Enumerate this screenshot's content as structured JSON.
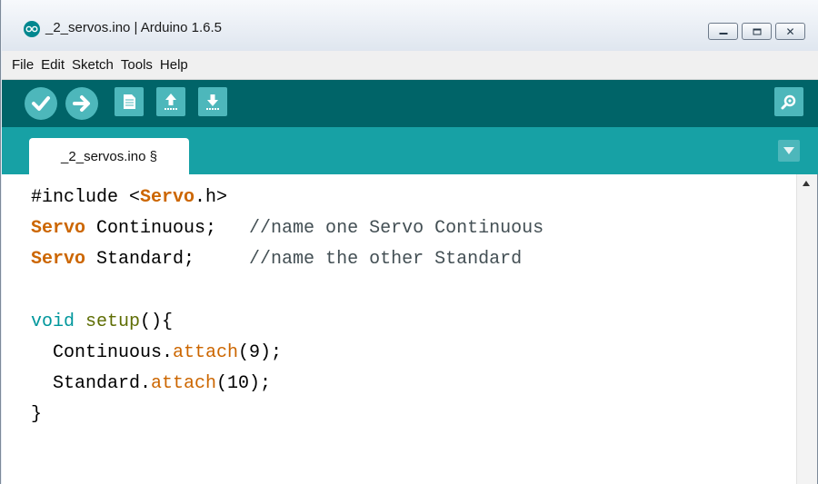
{
  "window": {
    "title": "_2_servos.ino | Arduino 1.6.5",
    "controls": [
      "minimize",
      "maximize",
      "close"
    ]
  },
  "menu": {
    "items": [
      "File",
      "Edit",
      "Sketch",
      "Tools",
      "Help"
    ]
  },
  "toolbar": {
    "buttons": [
      "verify-icon",
      "upload-icon",
      "new-icon",
      "open-icon",
      "save-icon",
      "serial-monitor-icon"
    ]
  },
  "tabs": [
    {
      "label": "_2_servos.ino §"
    }
  ],
  "editor": {
    "lines": [
      [
        {
          "t": "#include <",
          "c": ""
        },
        {
          "t": "Servo",
          "c": "tp"
        },
        {
          "t": ".h>",
          "c": ""
        }
      ],
      [
        {
          "t": "Servo",
          "c": "tp"
        },
        {
          "t": " Continuous;   ",
          "c": ""
        },
        {
          "t": "//name one Servo Continuous",
          "c": "cm"
        }
      ],
      [
        {
          "t": "Servo",
          "c": "tp"
        },
        {
          "t": " Standard;     ",
          "c": ""
        },
        {
          "t": "//name the other Standard",
          "c": "cm"
        }
      ],
      [],
      [
        {
          "t": "void",
          "c": "kw2"
        },
        {
          "t": " ",
          "c": ""
        },
        {
          "t": "setup",
          "c": "fn2"
        },
        {
          "t": "(){",
          "c": ""
        }
      ],
      [
        {
          "t": "  Continuous.",
          "c": ""
        },
        {
          "t": "attach",
          "c": "fn"
        },
        {
          "t": "(9);",
          "c": ""
        }
      ],
      [
        {
          "t": "  Standard.",
          "c": ""
        },
        {
          "t": "attach",
          "c": "fn"
        },
        {
          "t": "(10);",
          "c": ""
        }
      ],
      [
        {
          "t": "}",
          "c": ""
        }
      ]
    ]
  },
  "colors": {
    "toolbar_bg": "#006468",
    "tabbar_bg": "#17a1a5",
    "button_bg": "#4db7bb",
    "keyword_orange": "#cc6600",
    "keyword_teal": "#00979c",
    "function_olive": "#5e6d03",
    "comment": "#434f54"
  }
}
